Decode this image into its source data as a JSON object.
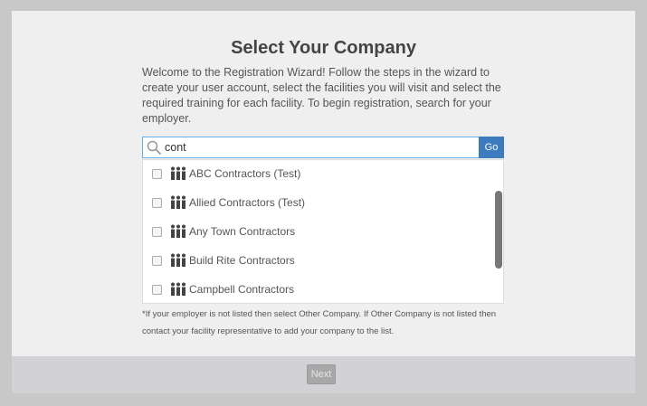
{
  "page": {
    "title": "Select Your Company",
    "intro": "Welcome to the Registration Wizard! Follow the steps in the wizard to create your user account, select the facilities you will visit and select the required training for each facility. To begin registration, search for your employer."
  },
  "search": {
    "value": "cont",
    "go_label": "Go",
    "icon": "search-icon"
  },
  "results": {
    "icon": "people-icon",
    "items": [
      {
        "label": "ABC Contractors (Test)",
        "checked": false
      },
      {
        "label": "Allied Contractors (Test)",
        "checked": false
      },
      {
        "label": "Any Town Contractors",
        "checked": false
      },
      {
        "label": "Build Rite Contractors",
        "checked": false
      },
      {
        "label": "Campbell Contractors",
        "checked": false
      }
    ]
  },
  "footnote": "*If your employer is not listed then select Other Company. If Other Company is not listed then contact your facility representative to add your company to the list.",
  "footer": {
    "next_label": "Next",
    "next_enabled": false
  },
  "colors": {
    "go_button": "#3d7bbf",
    "search_border": "#66afe9",
    "scroll_thumb": "#777777"
  }
}
